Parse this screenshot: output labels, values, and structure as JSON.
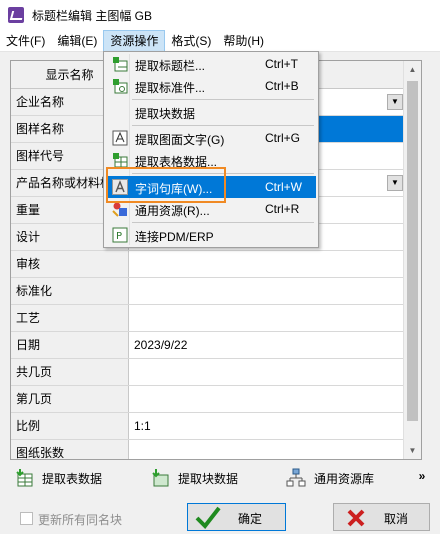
{
  "window": {
    "title": "标题栏编辑 主图幅 GB"
  },
  "menubar": {
    "items": [
      {
        "label": "文件(F)"
      },
      {
        "label": "编辑(E)"
      },
      {
        "label": "资源操作"
      },
      {
        "label": "格式(S)"
      },
      {
        "label": "帮助(H)"
      }
    ]
  },
  "grid": {
    "header": "显示名称",
    "rows": [
      {
        "label": "企业名称",
        "value": ""
      },
      {
        "label": "图样名称",
        "value": ""
      },
      {
        "label": "图样代号",
        "value": ""
      },
      {
        "label": "产品名称或材料标",
        "value": ""
      },
      {
        "label": "重量",
        "value": ""
      },
      {
        "label": "设计",
        "value": ""
      },
      {
        "label": "审核",
        "value": ""
      },
      {
        "label": "标准化",
        "value": ""
      },
      {
        "label": "工艺",
        "value": ""
      },
      {
        "label": "日期",
        "value": "2023/9/22"
      },
      {
        "label": "共几页",
        "value": ""
      },
      {
        "label": "第几页",
        "value": ""
      },
      {
        "label": "比例",
        "value": "1:1"
      },
      {
        "label": "图纸张数",
        "value": ""
      }
    ]
  },
  "resource_menu": {
    "items": [
      {
        "label": "提取标题栏...",
        "shortcut": "Ctrl+T",
        "icon": "title-bar-icon"
      },
      {
        "label": "提取标准件...",
        "shortcut": "Ctrl+B",
        "icon": "standard-part-icon"
      },
      {
        "label": "提取块数据",
        "shortcut": "",
        "icon": ""
      },
      {
        "label": "提取图面文字(G)",
        "shortcut": "Ctrl+G",
        "icon": "drawing-text-icon"
      },
      {
        "label": "提取表格数据...",
        "shortcut": "",
        "icon": "table-data-icon"
      },
      {
        "label": "字词句库(W)...",
        "shortcut": "Ctrl+W",
        "icon": "word-library-icon"
      },
      {
        "label": "通用资源(R)...",
        "shortcut": "Ctrl+R",
        "icon": "common-resource-icon"
      },
      {
        "label": "连接PDM/ERP",
        "shortcut": "",
        "icon": "pdm-erp-icon"
      }
    ]
  },
  "toolbar": {
    "extract_table": "提取表数据",
    "extract_block": "提取块数据",
    "common_resource": "通用资源库",
    "more": "»"
  },
  "footer": {
    "update_all_label": "更新所有同名块",
    "ok_label": "确定",
    "cancel_label": "取消"
  },
  "colors": {
    "selection": "#0078d7",
    "highlight_ring": "#f08a24",
    "menu_active": "#cce4f7"
  }
}
